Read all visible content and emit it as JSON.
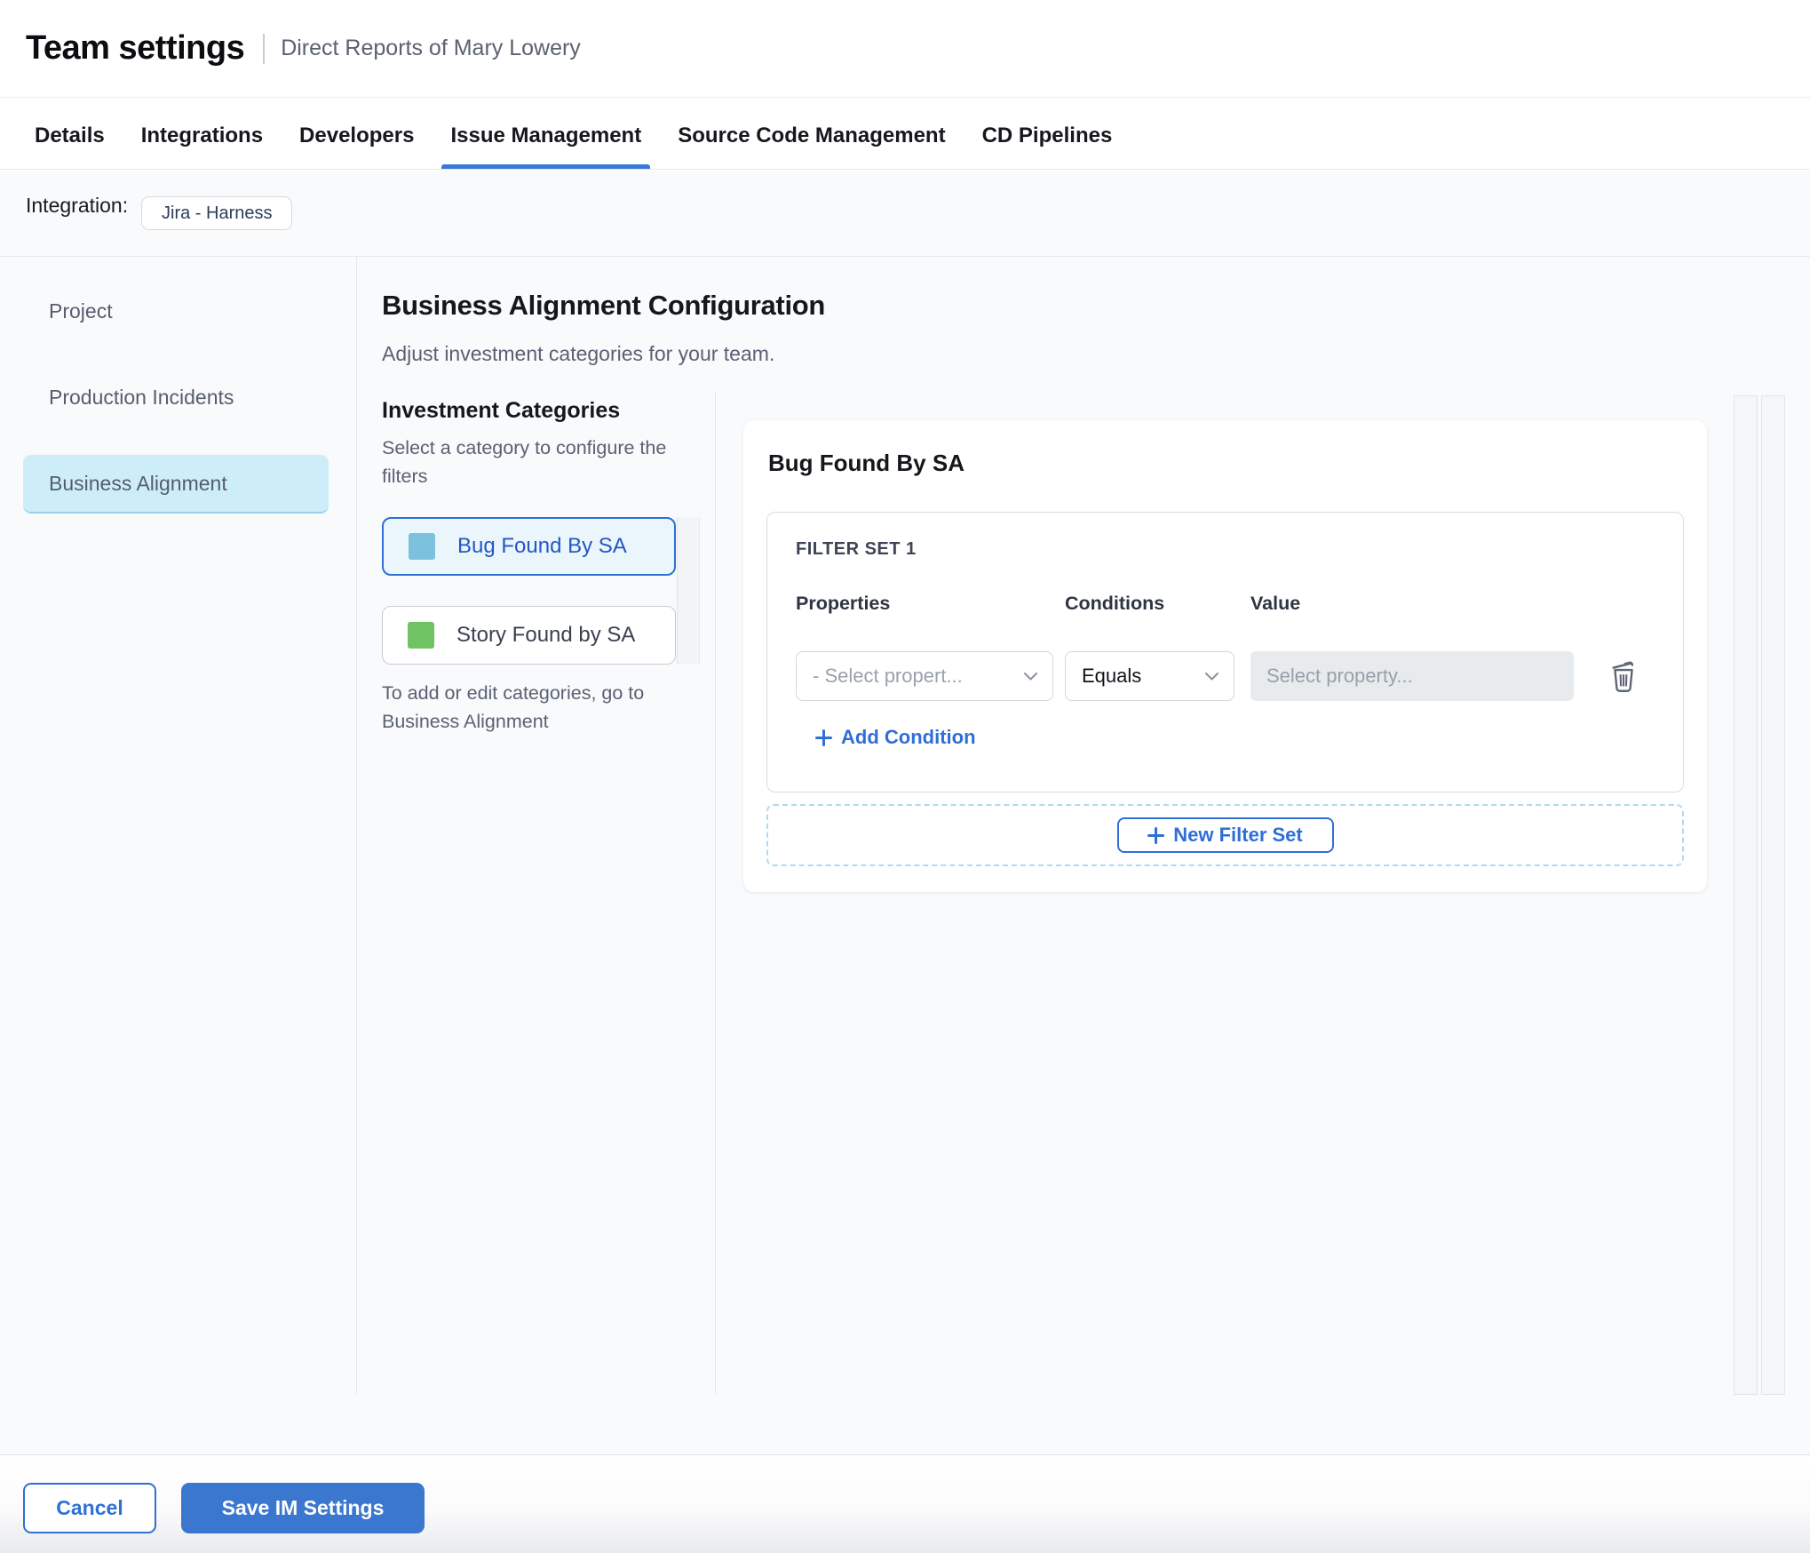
{
  "header": {
    "title": "Team settings",
    "subtitle": "Direct Reports of Mary Lowery"
  },
  "tabs": [
    {
      "label": "Details",
      "active": false
    },
    {
      "label": "Integrations",
      "active": false
    },
    {
      "label": "Developers",
      "active": false
    },
    {
      "label": "Issue Management",
      "active": true
    },
    {
      "label": "Source Code Management",
      "active": false
    },
    {
      "label": "CD Pipelines",
      "active": false
    }
  ],
  "integration": {
    "label": "Integration:",
    "badge": "Jira - Harness"
  },
  "sidebar": {
    "items": [
      {
        "label": "Project",
        "active": false
      },
      {
        "label": "Production Incidents",
        "active": false
      },
      {
        "label": "Business Alignment",
        "active": true
      }
    ]
  },
  "main": {
    "heading": "Business Alignment Configuration",
    "subheading": "Adjust investment categories for your team.",
    "categories": {
      "heading": "Investment Categories",
      "description": "Select a category to configure the filters",
      "items": [
        {
          "label": "Bug Found By SA",
          "swatch_color": "#7cc1de",
          "selected": true
        },
        {
          "label": "Story Found by SA",
          "swatch_color": "#6fc362",
          "selected": false
        }
      ],
      "note": "To add or edit categories, go to Business Alignment"
    },
    "panel": {
      "title": "Bug Found By SA",
      "filter_set": {
        "title": "FILTER SET 1",
        "columns": [
          "Properties",
          "Conditions",
          "Value"
        ],
        "row": {
          "property_placeholder": "- Select propert...",
          "condition_value": "Equals",
          "value_placeholder": "Select property..."
        },
        "add_condition_label": "Add Condition"
      },
      "new_filter_set_label": "New Filter Set"
    }
  },
  "footer": {
    "cancel_label": "Cancel",
    "save_label": "Save IM Settings"
  },
  "colors": {
    "accent_blue": "#2f6fd6",
    "active_tab_underline": "#3778d8",
    "save_button_bg": "#3b77cf",
    "selected_sidebar_bg": "#cdeef9",
    "selected_category_bg": "#eaf6fc",
    "selected_category_text": "#2456c4",
    "bug_swatch": "#7cc1de",
    "story_swatch": "#6fc362",
    "content_bg": "#f8fafc",
    "value_input_bg": "#e7ebee",
    "dashed_border": "#b0d9ee"
  }
}
